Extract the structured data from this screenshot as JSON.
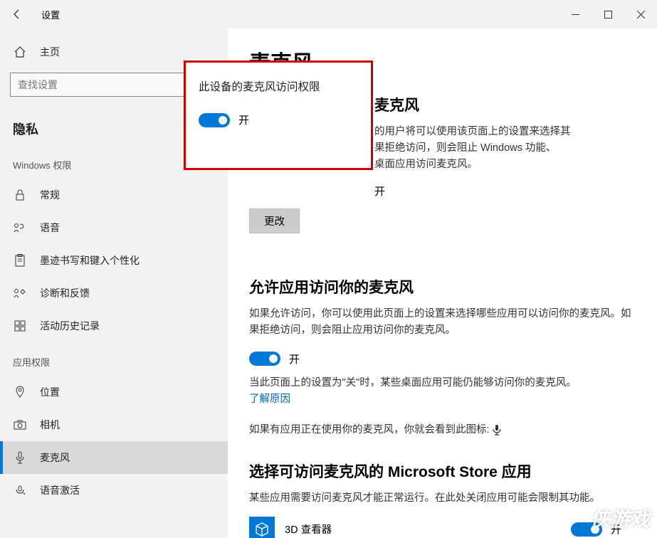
{
  "window": {
    "title": "设置"
  },
  "sidebar": {
    "home": "主页",
    "search_placeholder": "查找设置",
    "privacy_header": "隐私",
    "section_windows": "Windows 权限",
    "items_win": [
      {
        "label": "常规"
      },
      {
        "label": "语音"
      },
      {
        "label": "墨迹书写和键入个性化"
      },
      {
        "label": "诊断和反馈"
      },
      {
        "label": "活动历史记录"
      }
    ],
    "section_app": "应用权限",
    "items_app": [
      {
        "label": "位置"
      },
      {
        "label": "相机"
      },
      {
        "label": "麦克风"
      },
      {
        "label": "语音激活"
      }
    ]
  },
  "main": {
    "page_title": "麦克风",
    "section1": {
      "title_suffix": "麦克风",
      "desc_suffix": "的用户将可以使用该页面上的设置来选择其\n果拒绝访问，则会阻止 Windows 功能、\n桌面应用访问麦克风。",
      "status": "开",
      "change_btn": "更改"
    },
    "section2": {
      "title": "允许应用访问你的麦克风",
      "desc": "如果允许访问，你可以使用此页面上的设置来选择哪些应用可以访问你的麦克风。如果拒绝访问，则会阻止应用访问你的麦克风。",
      "toggle_label": "开",
      "note_prefix": "当此页面上的设置为\"关\"时，某些桌面应用可能仍能够访问你的麦克风。",
      "learn_why": "了解原因",
      "icon_note": "如果有应用正在使用你的麦克风，你就会看到此图标:"
    },
    "section3": {
      "title": "选择可访问麦克风的 Microsoft Store 应用",
      "desc": "某些应用需要访问麦克风才能正常运行。在此处关闭应用可能会限制其功能。",
      "apps": [
        {
          "name": "3D 查看器",
          "toggle": "开"
        }
      ]
    }
  },
  "callout": {
    "title": "此设备的麦克风访问权限",
    "toggle_label": "开"
  },
  "watermark": "侠游戏"
}
